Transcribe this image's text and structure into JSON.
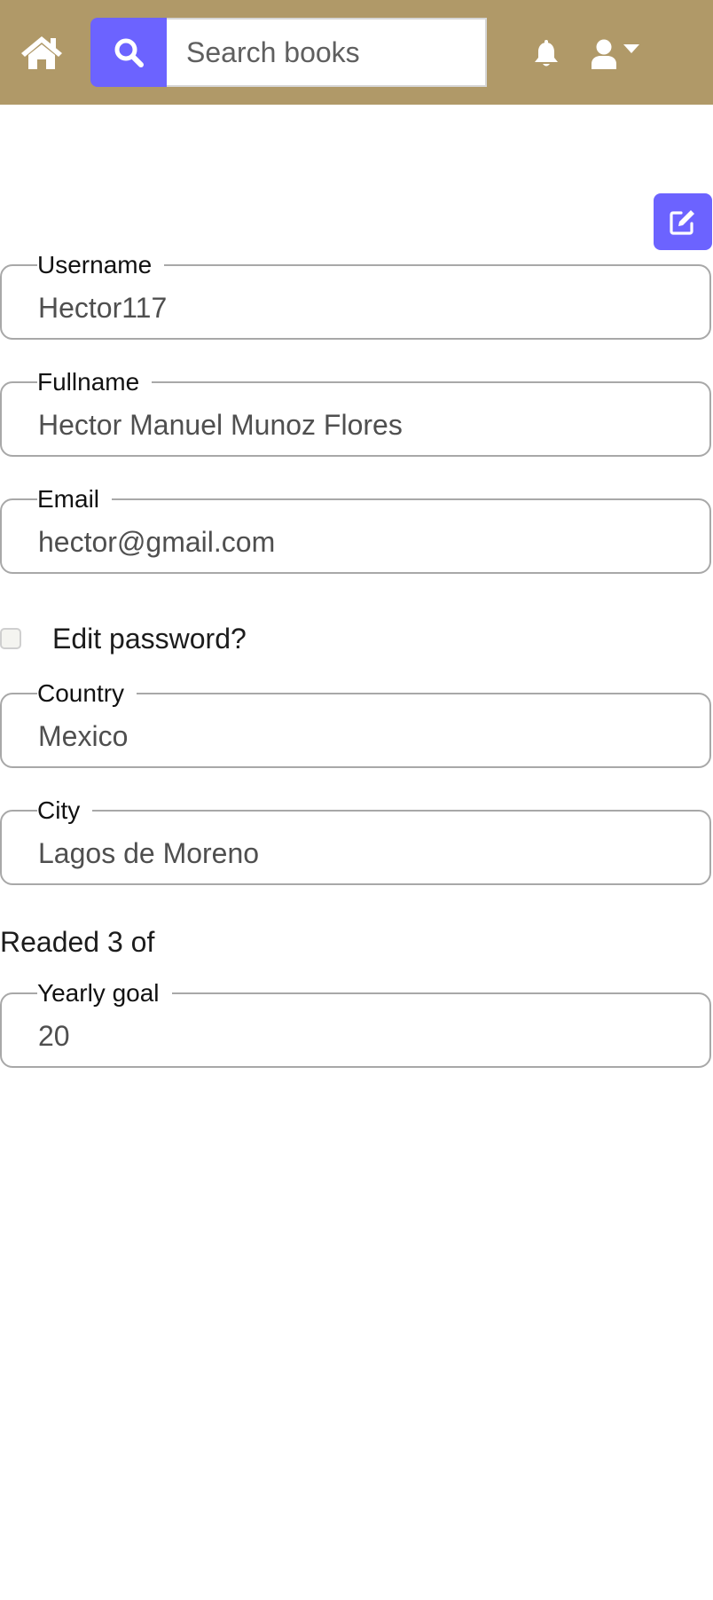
{
  "header": {
    "search": {
      "placeholder": "Search books",
      "value": ""
    },
    "icons": {
      "home": "home-icon",
      "search": "search-icon",
      "notifications": "bell-icon",
      "user": "user-icon",
      "dropdown": "caret-down-icon"
    },
    "colors": {
      "bar": "#b09968",
      "accent": "#6c63ff"
    }
  },
  "profile": {
    "edit_icon": "edit-icon",
    "fields": {
      "username": {
        "label": "Username",
        "value": "Hector117"
      },
      "fullname": {
        "label": "Fullname",
        "value": "Hector Manuel Munoz Flores"
      },
      "email": {
        "label": "Email",
        "value": "hector@gmail.com"
      },
      "country": {
        "label": "Country",
        "value": "Mexico"
      },
      "city": {
        "label": "City",
        "value": "Lagos de Moreno"
      },
      "yearly_goal": {
        "label": "Yearly goal",
        "value": "20"
      }
    },
    "edit_password": {
      "label": "Edit password?",
      "checked": false
    },
    "readed_text": "Readed 3 of"
  }
}
